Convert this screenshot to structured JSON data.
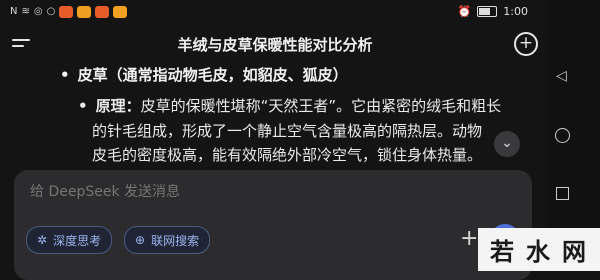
{
  "status_bar": {
    "left_glyphs": [
      "N",
      "≋",
      "◎",
      "○"
    ],
    "app_colors": [
      "#e85c2b",
      "#f0a020",
      "#e85c2b",
      "#f0a020"
    ],
    "right_glyphs": [
      "⏰",
      "📶"
    ],
    "time": "1:00"
  },
  "header": {
    "menu_icon": "hamburger-icon",
    "title": "羊绒与皮草保暖性能对比分析",
    "new_chat_icon": "plus-circle-icon",
    "new_chat_symbol": "+"
  },
  "content": {
    "bullet_symbol": "•",
    "heading": "皮草（通常指动物毛皮，如貂皮、狐皮）",
    "term": "原理：",
    "lines": [
      "皮草的保暖性堪称“天然王者”。它由紧密的绒毛和粗长",
      "的针毛组成，形成了一个静止空气含量极高的隔热层。动物",
      "皮毛的密度极高，能有效隔绝外部冷空气，锁住身体热量。"
    ],
    "scroll_symbol": "⌄"
  },
  "composer": {
    "placeholder": "给 DeepSeek 发送消息",
    "chips": [
      {
        "icon": "✲",
        "label": "深度思考"
      },
      {
        "icon": "⊕",
        "label": "联网搜索"
      }
    ],
    "plus_symbol": "+",
    "accent_color": "#4f6fd8"
  },
  "nav": {
    "back_symbol": "◁"
  },
  "watermark": {
    "chars": [
      "若",
      "水",
      "网"
    ]
  }
}
